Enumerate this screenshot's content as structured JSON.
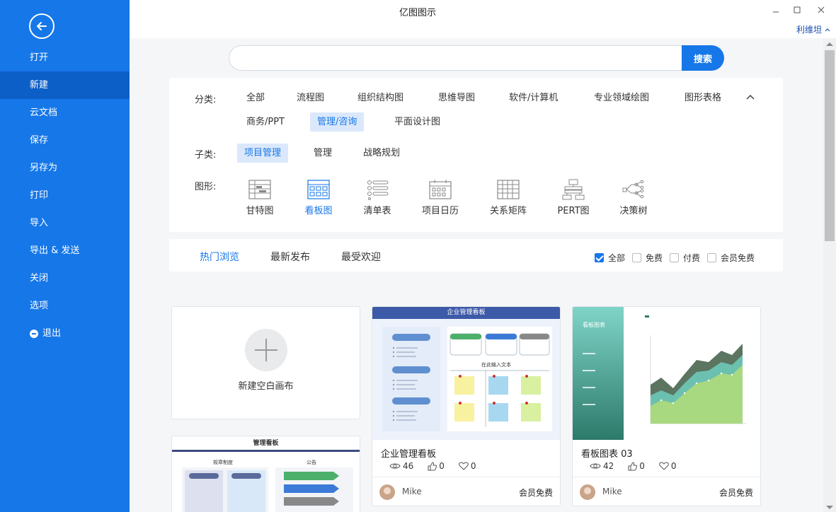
{
  "app": {
    "title": "亿图图示",
    "user": "利维坦"
  },
  "sidebar": {
    "items": [
      {
        "label": "打开"
      },
      {
        "label": "新建"
      },
      {
        "label": "云文档"
      },
      {
        "label": "保存"
      },
      {
        "label": "另存为"
      },
      {
        "label": "打印"
      },
      {
        "label": "导入"
      },
      {
        "label": "导出 & 发送"
      },
      {
        "label": "关闭"
      },
      {
        "label": "选项"
      },
      {
        "label": "退出"
      }
    ],
    "active": "新建"
  },
  "search": {
    "placeholder": "",
    "button": "搜索"
  },
  "filters": {
    "category_label": "分类:",
    "categories": [
      "全部",
      "流程图",
      "组织结构图",
      "思维导图",
      "软件/计算机",
      "专业领域绘图",
      "图形表格",
      "商务/PPT",
      "管理/咨询",
      "平面设计图"
    ],
    "category_selected": "管理/咨询",
    "subcategory_label": "子类:",
    "subcategories": [
      "项目管理",
      "管理",
      "战略规划"
    ],
    "subcategory_selected": "项目管理",
    "shape_label": "图形:",
    "shapes": [
      "甘特图",
      "看板图",
      "清单表",
      "项目日历",
      "关系矩阵",
      "PERT图",
      "决策树"
    ],
    "shape_selected": "看板图"
  },
  "tabs": {
    "items": [
      "热门浏览",
      "最新发布",
      "最受欢迎"
    ],
    "selected": "热门浏览"
  },
  "checks": [
    {
      "label": "全部",
      "checked": true
    },
    {
      "label": "免费",
      "checked": false
    },
    {
      "label": "付费",
      "checked": false
    },
    {
      "label": "会员免费",
      "checked": false
    }
  ],
  "new_card": {
    "label": "新建空白画布"
  },
  "templates": [
    {
      "title": "企业管理看板",
      "views": "46",
      "likes": "0",
      "favorites": "0",
      "author": "Mike",
      "price": "会员免费",
      "thumb_header": "企业管理看板",
      "thumb_caption": "在此输入文本"
    },
    {
      "title": "看板图表 03",
      "views": "42",
      "likes": "0",
      "favorites": "0",
      "author": "Mike",
      "price": "会员免费",
      "thumb_header": "看板图表"
    }
  ],
  "partial_template": {
    "thumb_header": "管理看板",
    "col1": "规章制度",
    "col2": "公告"
  },
  "colors": {
    "accent": "#1677e8",
    "sidebar_active": "#0d5fc8",
    "chip_bg": "#dbe8fb"
  }
}
